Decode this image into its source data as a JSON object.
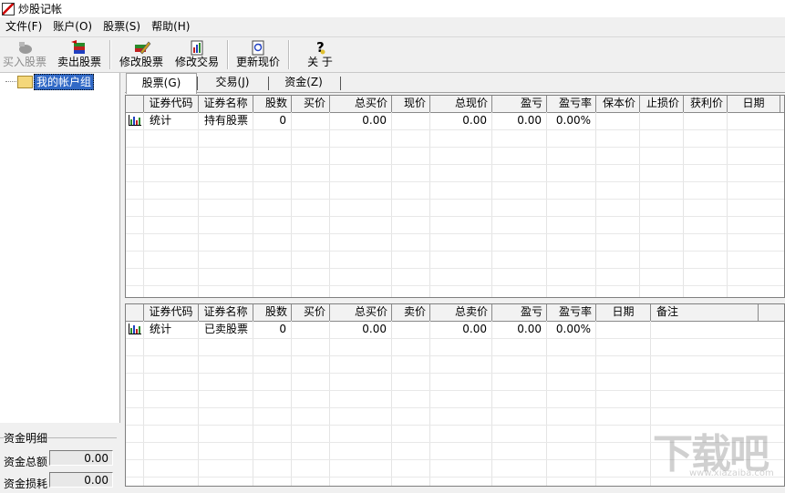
{
  "window": {
    "title": "炒股记帐"
  },
  "menu": [
    "文件(F)",
    "账户(O)",
    "股票(S)",
    "帮助(H)"
  ],
  "toolbar": {
    "buy": "买入股票",
    "sell": "卖出股票",
    "edit_stock": "修改股票",
    "edit_trade": "修改交易",
    "update_price": "更新现价",
    "about": "关 于"
  },
  "tree": {
    "root_label": "我的帐户组"
  },
  "tabs": [
    "股票(G)",
    "交易(J)",
    "资金(Z)"
  ],
  "holdings": {
    "columns": [
      "证券代码",
      "证券名称",
      "股数",
      "买价",
      "总买价",
      "现价",
      "总现价",
      "盈亏",
      "盈亏率",
      "保本价",
      "止损价",
      "获利价",
      "日期"
    ],
    "rows": [
      {
        "code": "统计",
        "name": "持有股票",
        "shares": "0",
        "buy_price": "",
        "total_buy": "0.00",
        "cur_price": "",
        "total_cur": "0.00",
        "pl": "0.00",
        "pl_rate": "0.00%",
        "breakeven": "",
        "stop_loss": "",
        "take_profit": "",
        "date": ""
      }
    ]
  },
  "sold": {
    "columns": [
      "证券代码",
      "证券名称",
      "股数",
      "买价",
      "总买价",
      "卖价",
      "总卖价",
      "盈亏",
      "盈亏率",
      "日期",
      "备注"
    ],
    "rows": [
      {
        "code": "统计",
        "name": "已卖股票",
        "shares": "0",
        "buy_price": "",
        "total_buy": "0.00",
        "sell_price": "",
        "total_sell": "0.00",
        "pl": "0.00",
        "pl_rate": "0.00%",
        "date": "",
        "note": ""
      }
    ]
  },
  "funds": {
    "title": "资金明细",
    "total_label": "资金总额",
    "total_value": "0.00",
    "loss_label": "资金损耗",
    "loss_value": "0.00"
  },
  "watermark": {
    "big": "下载吧",
    "small": "www.xiazaiba.com"
  }
}
